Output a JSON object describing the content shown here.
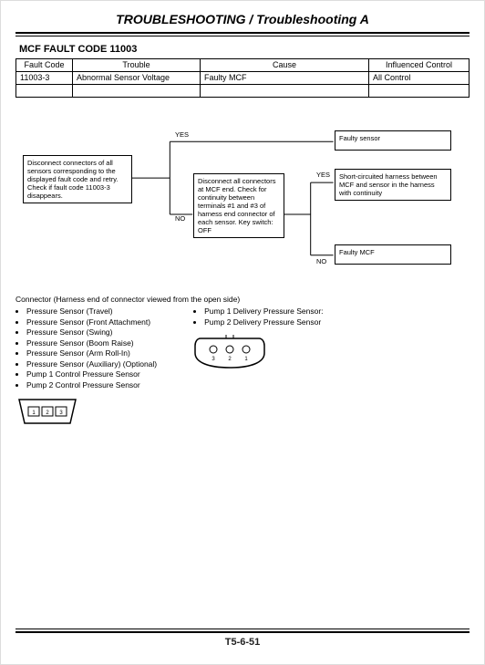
{
  "header": {
    "title": "TROUBLESHOOTING / Troubleshooting A"
  },
  "section_heading": "MCF FAULT CODE 11003",
  "table": {
    "headers": [
      "Fault Code",
      "Trouble",
      "Cause",
      "Influenced Control"
    ],
    "rows": [
      {
        "code": "11003-3",
        "trouble": "Abnormal Sensor Voltage",
        "cause": "Faulty MCF",
        "influenced": "All Control"
      },
      {
        "code": "",
        "trouble": "",
        "cause": "",
        "influenced": ""
      }
    ]
  },
  "flow": {
    "step1": "Disconnect connectors of all sensors corresponding to the displayed fault code and retry.\nCheck if fault code 11003-3 disappears.",
    "step2": "Disconnect all connectors at MCF end.\nCheck for continuity between terminals #1 and #3 of harness end connector of each sensor.\nKey switch: OFF",
    "result1": "Faulty sensor",
    "result2": "Short-circuited harness between MCF and sensor in the harness with continuity",
    "result3": "Faulty MCF",
    "labels": {
      "yes": "YES",
      "no": "NO"
    }
  },
  "notes": {
    "intro": "Connector (Harness end of connector viewed from the open side)",
    "left_items": [
      "Pressure Sensor (Travel)",
      "Pressure Sensor (Front Attachment)",
      "Pressure Sensor (Swing)",
      "Pressure Sensor (Boom Raise)",
      "Pressure Sensor (Arm Roll-In)",
      "Pressure Sensor (Auxiliary) (Optional)",
      "Pump 1 Control Pressure Sensor",
      "Pump 2 Control Pressure Sensor"
    ],
    "right_items": [
      "Pump 1 Delivery Pressure Sensor:",
      "Pump 2 Delivery Pressure Sensor"
    ],
    "pins_a": [
      "1",
      "2",
      "3"
    ],
    "pins_b": [
      "3",
      "2",
      "1"
    ]
  },
  "footer": {
    "pagenum": "T5-6-51"
  }
}
